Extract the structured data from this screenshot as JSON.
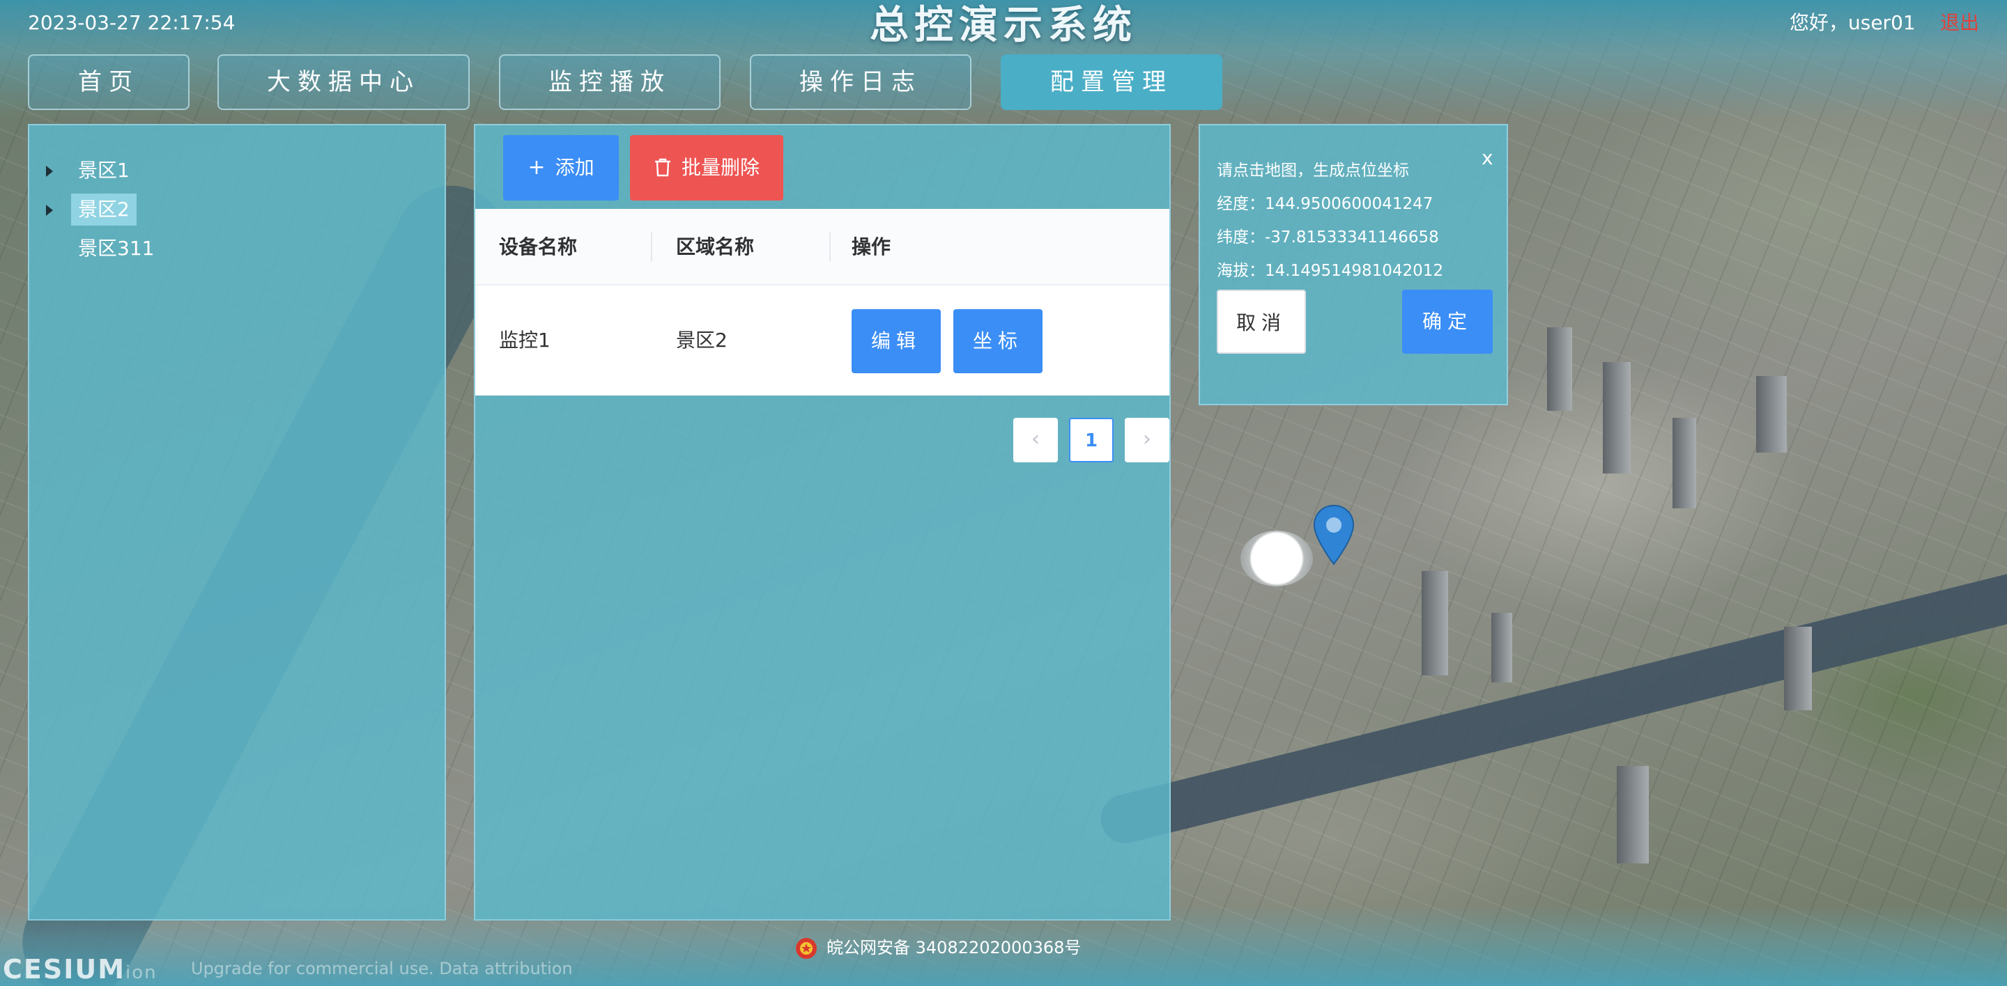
{
  "header": {
    "datetime": "2023-03-27 22:17:54",
    "title": "总控演示系统",
    "greeting": "您好，user01",
    "logout_label": "退出"
  },
  "nav": [
    {
      "label": "首页",
      "active": false
    },
    {
      "label": "大数据中心",
      "active": false
    },
    {
      "label": "监控播放",
      "active": false
    },
    {
      "label": "操作日志",
      "active": false
    },
    {
      "label": "配置管理",
      "active": true
    }
  ],
  "tree": [
    {
      "label": "景区1",
      "has_children": true,
      "selected": false
    },
    {
      "label": "景区2",
      "has_children": true,
      "selected": true
    },
    {
      "label": "景区311",
      "has_children": false,
      "selected": false
    }
  ],
  "toolbar": {
    "add_label": "添加",
    "add_icon": "plus-icon",
    "batch_delete_label": "批量删除",
    "batch_delete_icon": "trash-icon"
  },
  "table": {
    "columns": [
      "设备名称",
      "区域名称",
      "操作"
    ],
    "rows": [
      {
        "device": "监控1",
        "area": "景区2",
        "edit_label": "编辑",
        "coord_label": "坐标"
      }
    ]
  },
  "pagination": {
    "prev_icon": "chevron-left-icon",
    "current_page": "1",
    "next_icon": "chevron-right-icon"
  },
  "coord_dialog": {
    "close_label": "x",
    "prompt": "请点击地图，生成点位坐标",
    "longitude": "经度：144.9500600041247",
    "latitude": "纬度：-37.81533341146658",
    "altitude": "海拔：14.149514981042012",
    "cancel_label": "取消",
    "confirm_label": "确定"
  },
  "map": {
    "marker_icon": "map-pin-icon",
    "marker_color": "#2f84d6"
  },
  "footer": {
    "cesium_logo": "CESIUM",
    "cesium_ion": "ion",
    "cesium_credit": "Upgrade for commercial use. Data attribution",
    "beian_icon": "police-badge-icon",
    "beian_text": "皖公网安备 34082202000368号"
  },
  "colors": {
    "primary": "#3b8ef5",
    "danger": "#ee5452",
    "nav_active": "#4aaec6",
    "panel": "#5cbacd",
    "logout": "#e2413b"
  }
}
